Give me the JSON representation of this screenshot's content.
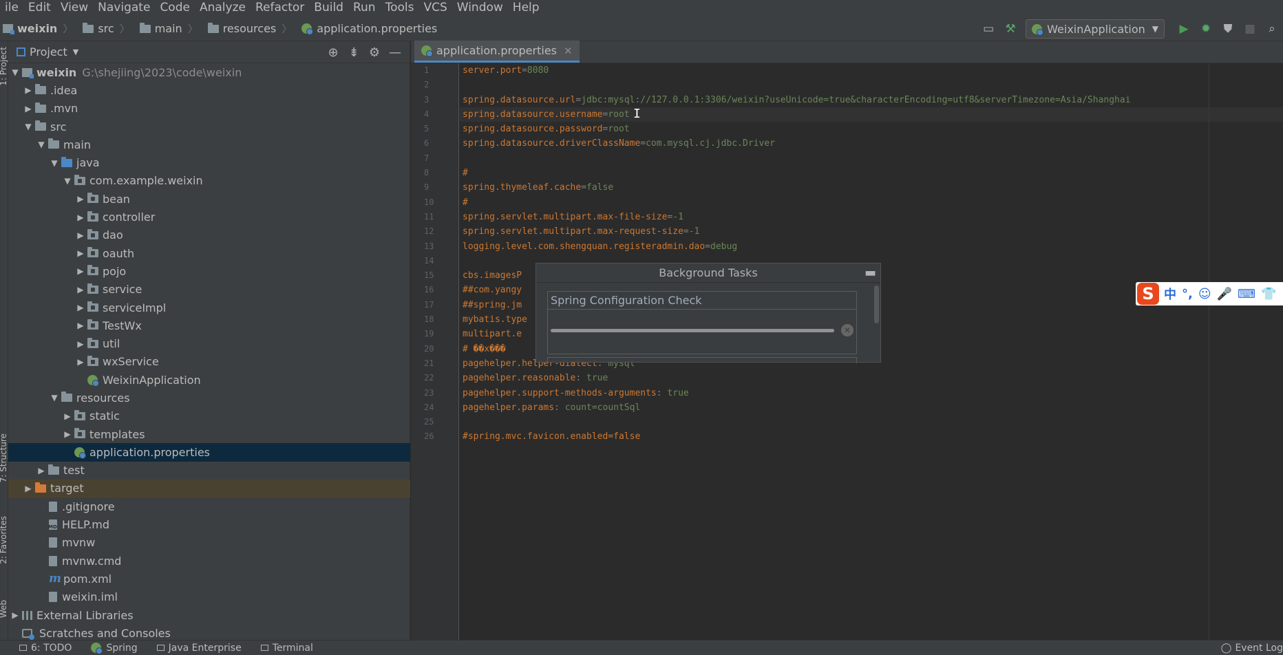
{
  "menu": [
    "ile",
    "Edit",
    "View",
    "Navigate",
    "Code",
    "Analyze",
    "Refactor",
    "Build",
    "Run",
    "Tools",
    "VCS",
    "Window",
    "Help"
  ],
  "breadcrumb": {
    "project": "weixin",
    "items": [
      "src",
      "main",
      "resources",
      "application.properties"
    ]
  },
  "run_config": "WeixinApplication",
  "left_strip": [
    "1: Project",
    "7: Structure",
    "2: Favorites",
    "Web"
  ],
  "project_panel": {
    "title": "Project",
    "root_name": "weixin",
    "root_path": "G:\\shejiing\\2023\\code\\weixin",
    "nodes": [
      {
        "label": ".idea"
      },
      {
        "label": ".mvn"
      },
      {
        "label": "src"
      },
      {
        "label": "main"
      },
      {
        "label": "java"
      },
      {
        "label": "com.example.weixin"
      },
      {
        "label": "bean"
      },
      {
        "label": "controller"
      },
      {
        "label": "dao"
      },
      {
        "label": "oauth"
      },
      {
        "label": "pojo"
      },
      {
        "label": "service"
      },
      {
        "label": "serviceImpl"
      },
      {
        "label": "TestWx"
      },
      {
        "label": "util"
      },
      {
        "label": "wxService"
      },
      {
        "label": "WeixinApplication"
      },
      {
        "label": "resources"
      },
      {
        "label": "static"
      },
      {
        "label": "templates"
      },
      {
        "label": "application.properties"
      },
      {
        "label": "test"
      },
      {
        "label": "target"
      },
      {
        "label": ".gitignore"
      },
      {
        "label": "HELP.md"
      },
      {
        "label": "mvnw"
      },
      {
        "label": "mvnw.cmd"
      },
      {
        "label": "pom.xml"
      },
      {
        "label": "weixin.iml"
      },
      {
        "label": "External Libraries"
      },
      {
        "label": "Scratches and Consoles"
      }
    ]
  },
  "editor": {
    "tab": "application.properties",
    "lines": [
      {
        "n": "1",
        "k": "server.port",
        "eq": "=",
        "v": "8080"
      },
      {
        "n": "2",
        "k": "",
        "eq": "",
        "v": ""
      },
      {
        "n": "3",
        "k": "spring.datasource.url",
        "eq": "=",
        "v": "jdbc:mysql://127.0.0.1:3306/weixin?useUnicode=true&characterEncoding=utf8&serverTimezone=Asia/Shanghai"
      },
      {
        "n": "4",
        "k": "spring.datasource.username",
        "eq": "=",
        "v": "root"
      },
      {
        "n": "5",
        "k": "spring.datasource.password",
        "eq": "=",
        "v": "root"
      },
      {
        "n": "6",
        "k": "spring.datasource.driverClassName",
        "eq": "=",
        "v": "com.mysql.cj.jdbc.Driver"
      },
      {
        "n": "7",
        "k": "",
        "eq": "",
        "v": ""
      },
      {
        "n": "8",
        "k": "#",
        "eq": "",
        "v": ""
      },
      {
        "n": "9",
        "k": "spring.thymeleaf.cache",
        "eq": "=",
        "v": "false"
      },
      {
        "n": "10",
        "k": "#",
        "eq": "",
        "v": ""
      },
      {
        "n": "11",
        "k": "spring.servlet.multipart.max-file-size",
        "eq": "=",
        "v": "-1"
      },
      {
        "n": "12",
        "k": "spring.servlet.multipart.max-request-size",
        "eq": "=",
        "v": "-1"
      },
      {
        "n": "13",
        "k": "logging.level.com.shengquan.registeradmin.dao",
        "eq": "=",
        "v": "debug"
      },
      {
        "n": "14",
        "k": "",
        "eq": "",
        "v": ""
      },
      {
        "n": "15",
        "k": "cbs.imagesP",
        "eq": "",
        "v": ""
      },
      {
        "n": "16",
        "k": "##com.yangy",
        "eq": "",
        "v": ""
      },
      {
        "n": "17",
        "k": "##spring.jm",
        "eq": "",
        "v": ""
      },
      {
        "n": "18",
        "k": "mybatis.type",
        "eq": "",
        "v": ""
      },
      {
        "n": "19",
        "k": "multipart.e",
        "eq": "",
        "v": ""
      },
      {
        "n": "20",
        "k": "# ��x���",
        "eq": "",
        "v": ""
      },
      {
        "n": "21",
        "k": "pagehelper.helper-dialect",
        "eq": ": ",
        "v": "mysql"
      },
      {
        "n": "22",
        "k": "pagehelper.reasonable",
        "eq": ": ",
        "v": "true"
      },
      {
        "n": "23",
        "k": "pagehelper.support-methods-arguments",
        "eq": ": ",
        "v": "true"
      },
      {
        "n": "24",
        "k": "pagehelper.params",
        "eq": ": ",
        "v": "count=countSql"
      },
      {
        "n": "25",
        "k": "",
        "eq": "",
        "v": ""
      },
      {
        "n": "26",
        "k": "#spring.mvc.favicon.enabled=false",
        "eq": "",
        "v": ""
      }
    ]
  },
  "background_tasks": {
    "title": "Background Tasks",
    "task_name": "Spring Configuration Check",
    "progress": 1.0
  },
  "ime": {
    "logo": "S",
    "glyphs": [
      "中",
      "°,",
      "☺",
      "🎤",
      "⌨",
      "👕"
    ]
  },
  "status": {
    "items": [
      "6: TODO",
      "Spring",
      "Java Enterprise",
      "Terminal"
    ],
    "event_log": "Event Log"
  }
}
